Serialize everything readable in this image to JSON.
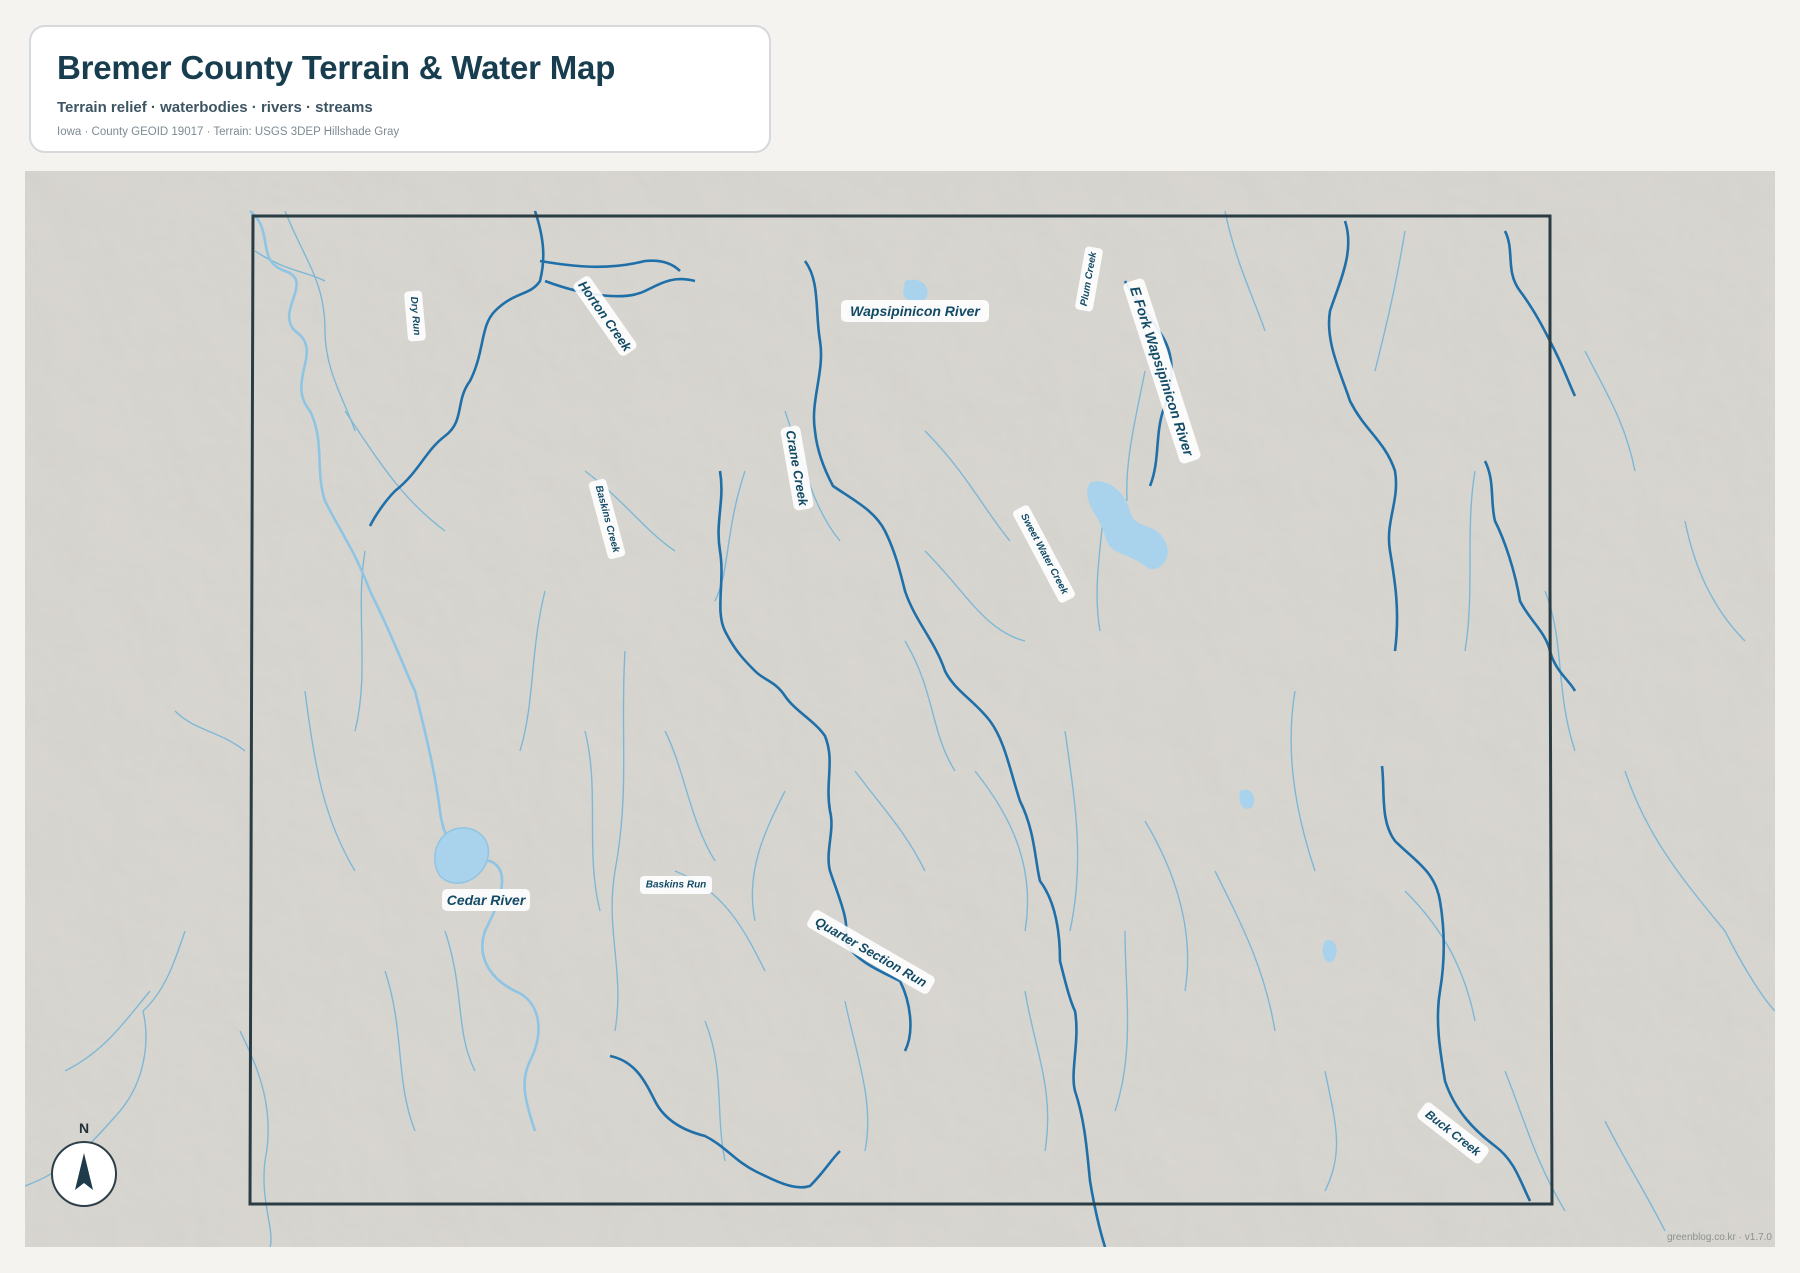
{
  "header": {
    "title": "Bremer County Terrain & Water Map",
    "subtitle": "Terrain relief · waterbodies · rivers · streams",
    "source": "Iowa · County GEOID 19017 · Terrain: USGS 3DEP Hillshade Gray"
  },
  "map": {
    "north_label": "N",
    "credit": "greenblog.co.kr · v1.7.0",
    "colors": {
      "terrain": "#d2cfc8",
      "border": "#2a3d44",
      "river_major": "#1f6fa8",
      "stream_minor": "#6fb3d8",
      "waterbody": "#a9d3ec",
      "label_text": "#134b66"
    },
    "labels": {
      "dry_run": "Dry Run",
      "horton_creek": "Horton Creek",
      "wapsipinicon_river": "Wapsipinicon River",
      "plum_creek": "Plum Creek",
      "e_fork_wapsipinicon_river": "E Fork Wapsipinicon River",
      "crane_creek": "Crane Creek",
      "baskins_creek": "Baskins Creek",
      "sweet_water_creek": "Sweet Water Creek",
      "cedar_river": "Cedar River",
      "baskins_run": "Baskins Run",
      "quarter_section_run": "Quarter Section Run",
      "buck_creek": "Buck Creek"
    }
  }
}
